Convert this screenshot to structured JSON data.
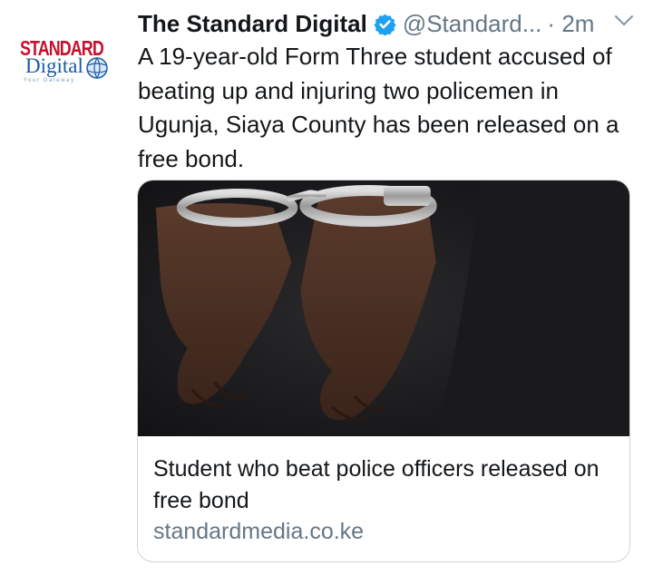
{
  "tweet": {
    "author_name": "The Standard Digital",
    "handle": "@Standard...",
    "separator": "·",
    "time": "2m",
    "text": "A 19-year-old Form Three student accused of beating up and injuring two policemen in Ugunja, Siaya County has been released on a free bond."
  },
  "avatar": {
    "brand_top": "STANDARD",
    "brand_bottom": "Digital",
    "tagline": "Your Gateway"
  },
  "icons": {
    "verified": "verified-badge-icon",
    "menu": "chevron-down-icon",
    "image": "handcuffed-hands-photo"
  },
  "card": {
    "title": "Student who beat police officers released on free bond",
    "domain": "standardmedia.co.ke"
  },
  "colors": {
    "verified": "#1da1f2",
    "secondary_text": "#657786",
    "brand_red": "#c8102e",
    "brand_blue": "#1c5aa6",
    "card_border": "#ccd6dd"
  }
}
